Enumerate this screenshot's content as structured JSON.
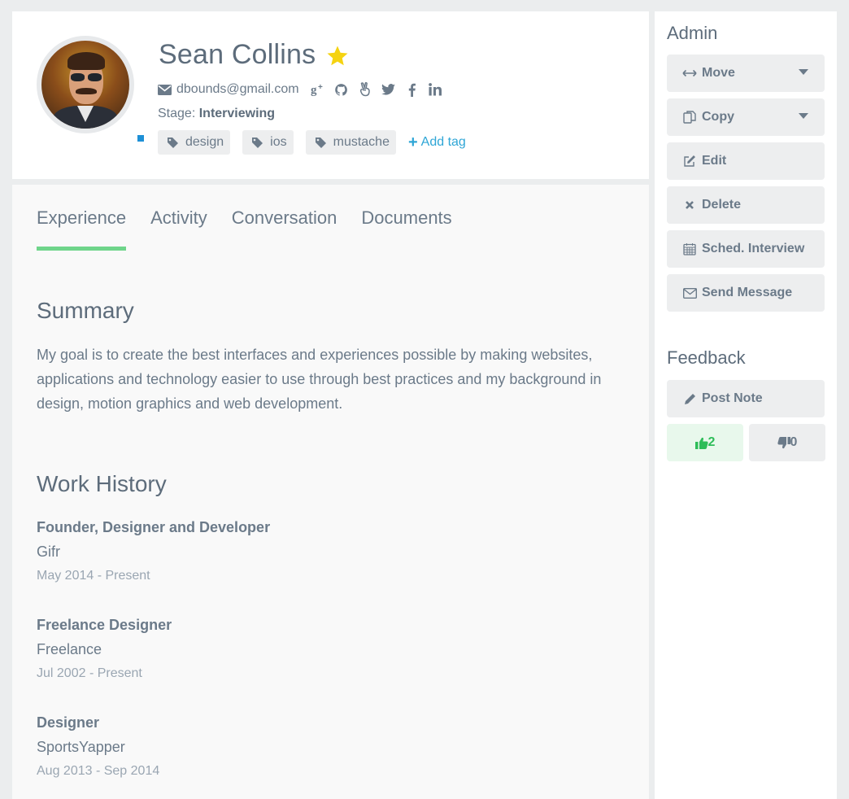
{
  "profile": {
    "name": "Sean Collins",
    "email": "dbounds@gmail.com",
    "stage_label": "Stage:",
    "stage_value": "Interviewing",
    "social_icons": [
      "google-plus-icon",
      "github-icon",
      "angellist-icon",
      "twitter-icon",
      "facebook-icon",
      "linkedin-icon"
    ],
    "tags": [
      "design",
      "ios",
      "mustache"
    ],
    "add_tag_label": "Add tag"
  },
  "tabs": [
    {
      "label": "Experience",
      "active": true
    },
    {
      "label": "Activity",
      "active": false
    },
    {
      "label": "Conversation",
      "active": false
    },
    {
      "label": "Documents",
      "active": false
    }
  ],
  "summary": {
    "title": "Summary",
    "text": "My goal is to create the best interfaces and experiences possible by making websites, applications and technology easier to use through best practices and my background in design, motion graphics and web development."
  },
  "work_history": {
    "title": "Work History",
    "jobs": [
      {
        "title": "Founder, Designer and Developer",
        "company": "Gifr",
        "dates": "May 2014 - Present"
      },
      {
        "title": "Freelance Designer",
        "company": "Freelance",
        "dates": "Jul 2002 - Present"
      },
      {
        "title": "Designer",
        "company": "SportsYapper",
        "dates": "Aug 2013 - Sep 2014"
      }
    ]
  },
  "sidebar": {
    "admin_title": "Admin",
    "admin_buttons": [
      {
        "label": "Move",
        "icon": "arrows-horizontal-icon",
        "dropdown": true
      },
      {
        "label": "Copy",
        "icon": "copy-icon",
        "dropdown": true
      },
      {
        "label": "Edit",
        "icon": "edit-icon",
        "dropdown": false
      },
      {
        "label": "Delete",
        "icon": "close-icon",
        "dropdown": false
      },
      {
        "label": "Sched. Interview",
        "icon": "calendar-icon",
        "dropdown": false
      },
      {
        "label": "Send Message",
        "icon": "envelope-icon",
        "dropdown": false
      }
    ],
    "feedback_title": "Feedback",
    "post_note_label": "Post Note",
    "thumbs_up_count": "2",
    "thumbs_down_count": "0"
  },
  "colors": {
    "accent_green": "#6fd58b",
    "link_blue": "#2fa6d6",
    "star_yellow": "#f5d311",
    "upvote_green": "#2ebd59"
  }
}
